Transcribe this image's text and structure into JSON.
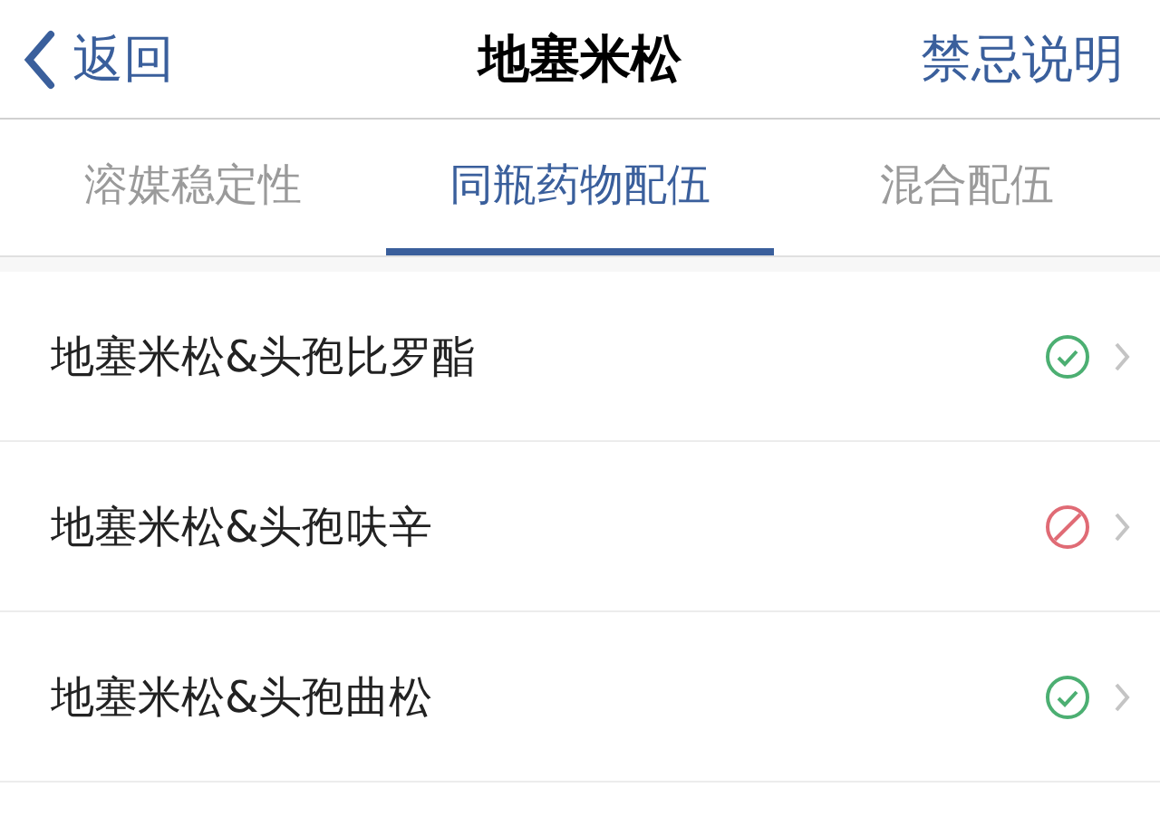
{
  "header": {
    "back": "返回",
    "title": "地塞米松",
    "action": "禁忌说明"
  },
  "tabs": [
    {
      "label": "溶媒稳定性",
      "selected": false
    },
    {
      "label": "同瓶药物配伍",
      "selected": true
    },
    {
      "label": "混合配伍",
      "selected": false
    }
  ],
  "rows": [
    {
      "name": "地塞米松&头孢比罗酯",
      "kind": "compatible"
    },
    {
      "name": "地塞米松&头孢呋辛",
      "kind": "incompatible"
    },
    {
      "name": "地塞米松&头孢曲松",
      "kind": "compatible"
    }
  ]
}
